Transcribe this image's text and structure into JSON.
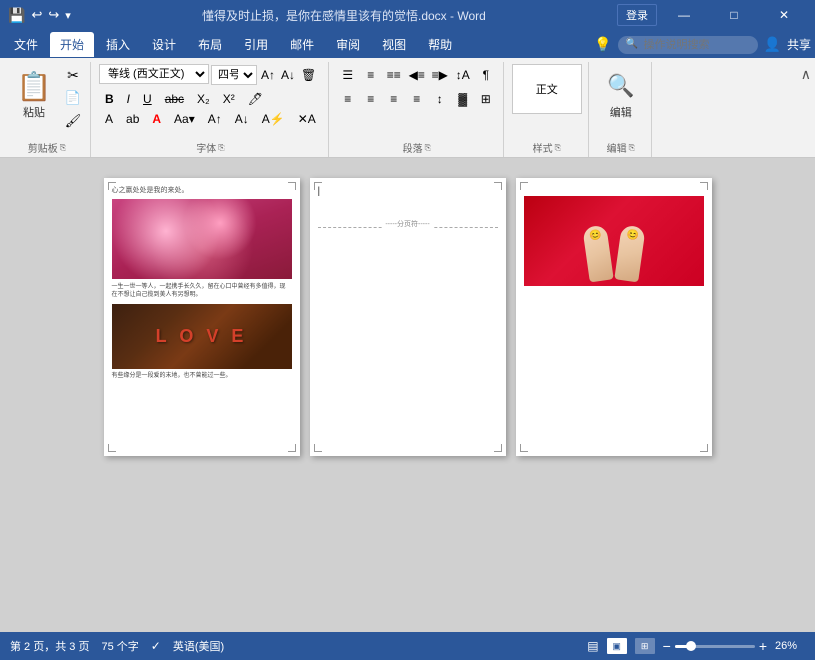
{
  "titleBar": {
    "title": "懂得及时止损，是你在感情里该有的觉悟.docx - Word",
    "loginBtn": "登录",
    "windowBtns": [
      "—",
      "□",
      "✕"
    ]
  },
  "quickAccess": {
    "save": "💾",
    "undo": "↩",
    "redo": "↪"
  },
  "menuBar": {
    "items": [
      "文件",
      "开始",
      "插入",
      "设计",
      "布局",
      "引用",
      "邮件",
      "审阅",
      "视图",
      "帮助"
    ],
    "activeItem": "开始",
    "lightbulb": "💡",
    "searchPlaceholder": "操作说明搜索",
    "shareBtn": "共享"
  },
  "ribbon": {
    "groups": [
      {
        "name": "剪贴板",
        "label": "剪贴板"
      },
      {
        "name": "字体",
        "label": "字体",
        "fontName": "等线 (西文正文)",
        "fontSize": "四号",
        "expand": "▾"
      },
      {
        "name": "段落",
        "label": "段落"
      },
      {
        "name": "样式",
        "label": "样式"
      },
      {
        "name": "编辑",
        "label": "编辑"
      }
    ]
  },
  "pages": [
    {
      "id": 1,
      "topText": "心之赢处处是我的来处。",
      "midText": "一生一世一等人，一起携手长久久，留在心口中曾经有多值得，现 在不想让自己揽到美人有另想明。",
      "bottomText": "有些缘分是一段爱的末地，也不曾能过一些。"
    },
    {
      "id": 2,
      "dividerLabel": "-----分页符-----",
      "cursor": "|"
    },
    {
      "id": 3
    }
  ],
  "statusBar": {
    "pageInfo": "第 2 页，共 3 页",
    "wordCount": "75 个字",
    "language": "英语(美国)",
    "zoom": "26%",
    "views": [
      "▤",
      "▣",
      "▥"
    ]
  }
}
